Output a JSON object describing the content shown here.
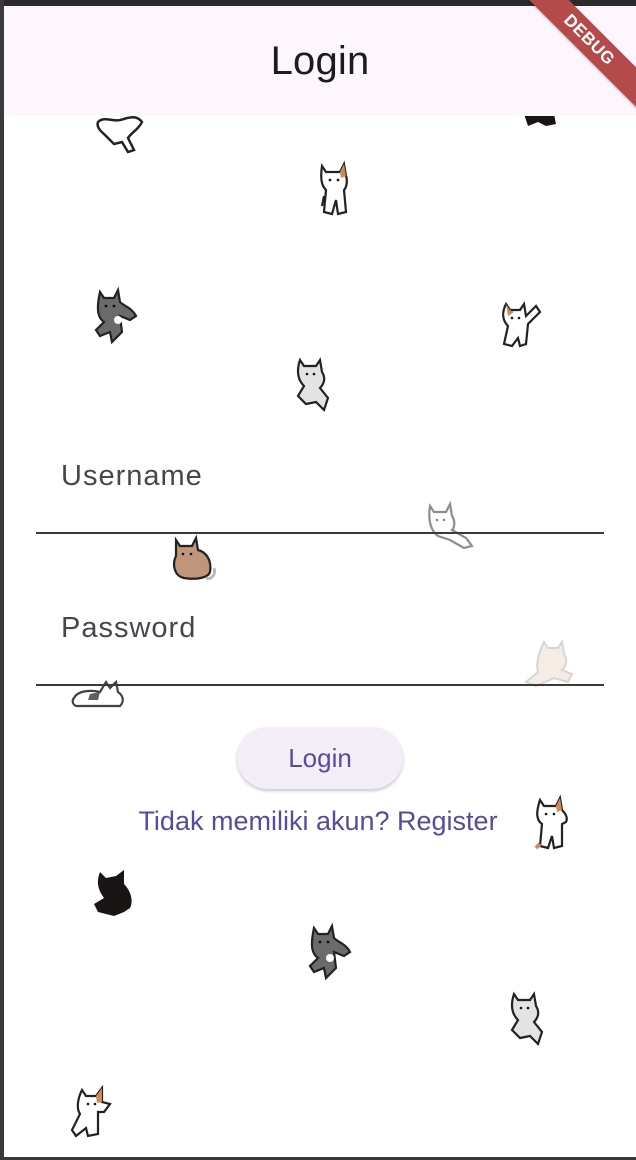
{
  "app_bar": {
    "title": "Login"
  },
  "debug_banner": {
    "label": "DEBUG"
  },
  "form": {
    "username": {
      "label": "Username",
      "value": ""
    },
    "password": {
      "label": "Password",
      "value": ""
    },
    "login_button": "Login",
    "register_link": "Tidak memiliki akun? Register"
  },
  "colors": {
    "app_bar_bg": "#fdf7fd",
    "accent_text": "#5a4a9c",
    "debug_banner": "#b44a4a"
  },
  "decorations": [
    {
      "name": "cat-white-icon"
    },
    {
      "name": "cat-calico-icon"
    },
    {
      "name": "cat-gray-icon"
    },
    {
      "name": "cat-light-gray-icon"
    },
    {
      "name": "cat-brown-icon"
    },
    {
      "name": "cat-black-icon"
    }
  ]
}
